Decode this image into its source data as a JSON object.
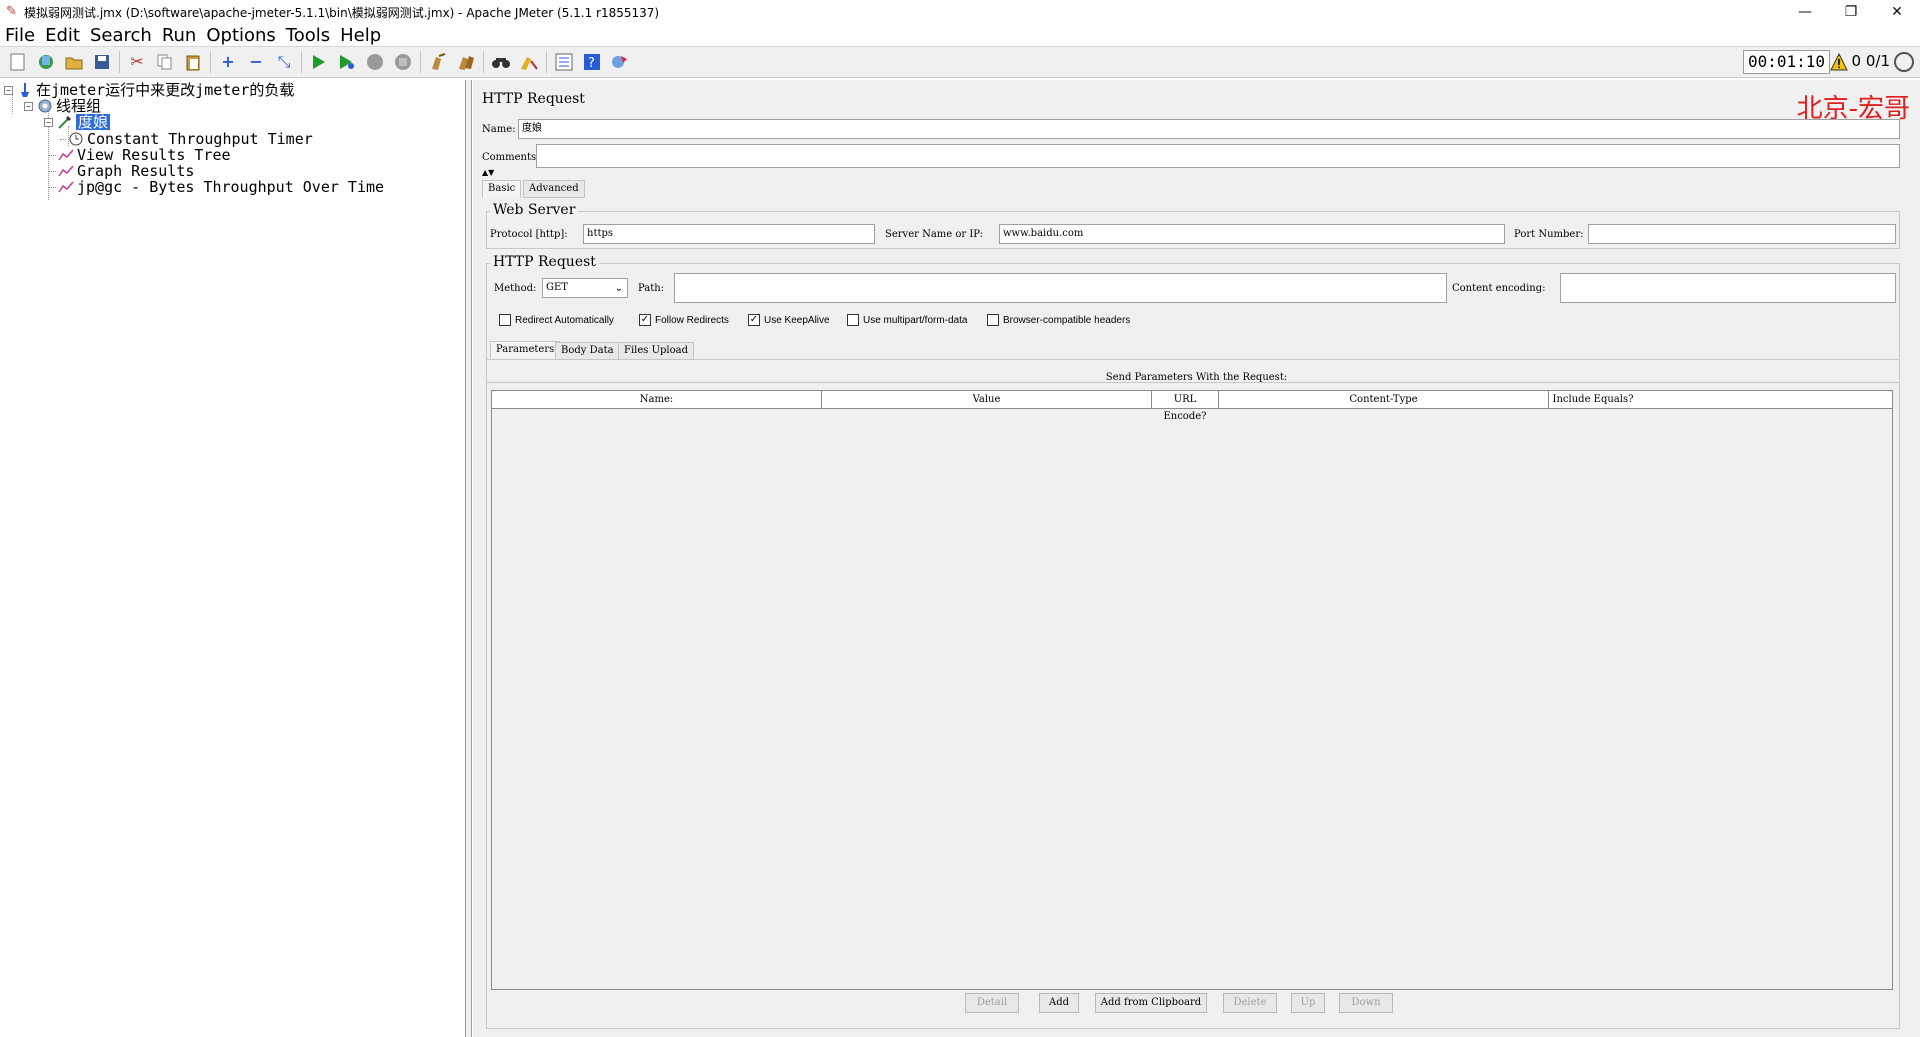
{
  "window": {
    "title": "模拟弱网测试.jmx (D:\\software\\apache-jmeter-5.1.1\\bin\\模拟弱网测试.jmx) - Apache JMeter (5.1.1 r1855137)",
    "minimize": "—",
    "restore": "❐",
    "close": "✕"
  },
  "menu": [
    "File",
    "Edit",
    "Search",
    "Run",
    "Options",
    "Tools",
    "Help"
  ],
  "status": {
    "elapsed": "00:01:10",
    "warnings": "0",
    "threads": "0/1"
  },
  "tree": {
    "root": "在jmeter运行中来更改jmeter的负载",
    "thread_group": "线程组",
    "sampler": "度娘",
    "timer": "Constant Throughput Timer",
    "listener1": "View Results Tree",
    "listener2": "Graph Results",
    "listener3": "jp@gc - Bytes Throughput Over Time"
  },
  "panel": {
    "title": "HTTP Request",
    "watermark": "北京-宏哥",
    "name_label": "Name:",
    "name_value": "度娘",
    "comments_label": "Comments:",
    "tabs": [
      "Basic",
      "Advanced"
    ],
    "web_server": {
      "title": "Web Server",
      "protocol_label": "Protocol [http]:",
      "protocol_value": "https",
      "server_label": "Server Name or IP:",
      "server_value": "www.baidu.com",
      "port_label": "Port Number:",
      "port_value": ""
    },
    "http_request": {
      "title": "HTTP Request",
      "method_label": "Method:",
      "method_value": "GET",
      "path_label": "Path:",
      "path_value": "",
      "encoding_label": "Content encoding:",
      "encoding_value": ""
    },
    "checkboxes": [
      {
        "label": "Redirect Automatically",
        "checked": false
      },
      {
        "label": "Follow Redirects",
        "checked": true
      },
      {
        "label": "Use KeepAlive",
        "checked": true
      },
      {
        "label": "Use multipart/form-data",
        "checked": false
      },
      {
        "label": "Browser-compatible headers",
        "checked": false
      }
    ],
    "sub_tabs": [
      "Parameters",
      "Body Data",
      "Files Upload"
    ],
    "params_caption": "Send Parameters With the Request:",
    "columns": [
      "Name:",
      "Value",
      "URL Encode?",
      "Content-Type",
      "Include Equals?"
    ],
    "buttons": {
      "detail": "Detail",
      "add": "Add",
      "add_clipboard": "Add from Clipboard",
      "delete": "Delete",
      "up": "Up",
      "down": "Down"
    }
  }
}
